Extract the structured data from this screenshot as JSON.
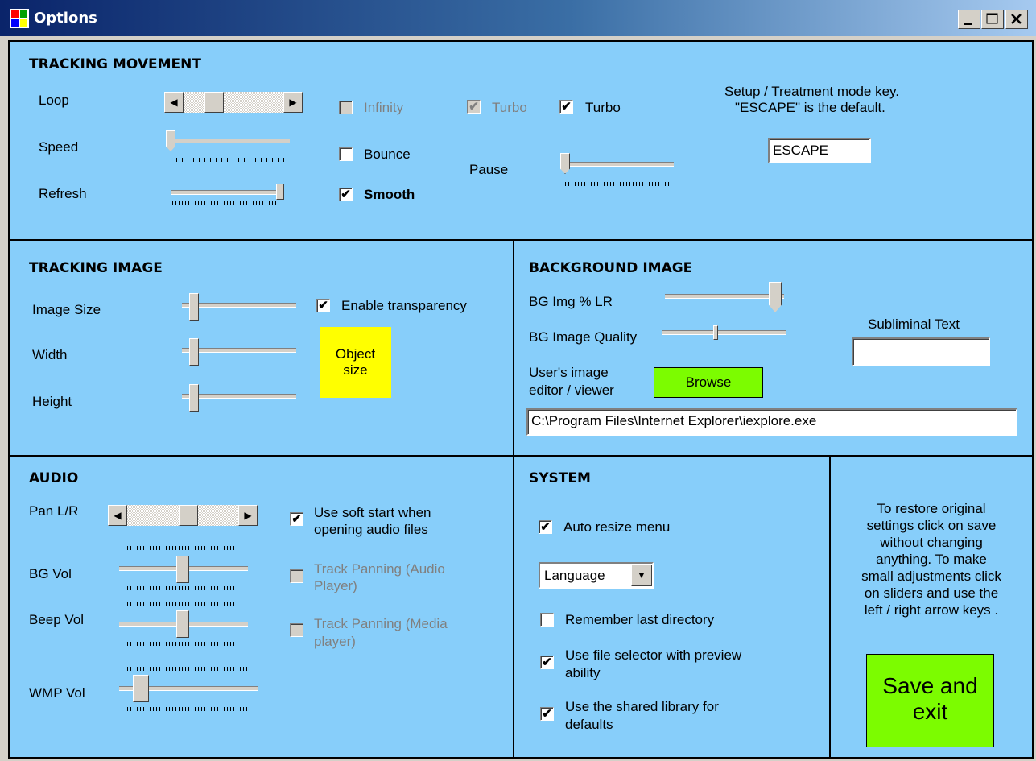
{
  "window": {
    "title": "Options",
    "minimize_icon": "minimize-icon",
    "maximize_icon": "maximize-icon",
    "close_icon": "close-icon"
  },
  "tracking_movement": {
    "heading": "TRACKING MOVEMENT",
    "loop_label": "Loop",
    "speed_label": "Speed",
    "refresh_label": "Refresh",
    "infinity_label": "Infinity",
    "infinity_checked": false,
    "infinity_enabled": false,
    "turbo_disabled_label": "Turbo",
    "turbo_disabled_checked": true,
    "turbo_label": "Turbo",
    "turbo_checked": true,
    "bounce_label": "Bounce",
    "bounce_checked": false,
    "smooth_label": "Smooth",
    "smooth_checked": true,
    "pause_label": "Pause",
    "mode_key_hint_line1": "Setup / Treatment mode key.",
    "mode_key_hint_line2": "\"ESCAPE\" is the default.",
    "mode_key_value": "ESCAPE"
  },
  "tracking_image": {
    "heading": "TRACKING IMAGE",
    "image_size_label": "Image Size",
    "width_label": "Width",
    "height_label": "Height",
    "transparency_label": "Enable transparency",
    "transparency_checked": true,
    "object_size_line1": "Object",
    "object_size_line2": "size",
    "object_size_color": "#ffff00"
  },
  "background_image": {
    "heading": "BACKGROUND IMAGE",
    "bg_lr_label": "BG Img % LR",
    "bg_quality_label": "BG Image Quality",
    "subliminal_label": "Subliminal Text",
    "subliminal_value": "",
    "editor_label_line1": "User's image",
    "editor_label_line2": "editor / viewer",
    "browse_label": "Browse",
    "browse_color": "#7cfc00",
    "editor_path": "C:\\Program Files\\Internet Explorer\\iexplore.exe"
  },
  "audio": {
    "heading": "AUDIO",
    "pan_label": "Pan L/R",
    "bg_vol_label": "BG Vol",
    "beep_vol_label": "Beep Vol",
    "wmp_vol_label": "WMP Vol",
    "soft_start_line1": "Use soft start when",
    "soft_start_line2": "opening audio files",
    "soft_start_checked": true,
    "track_panning_audio_line1": "Track Panning (Audio",
    "track_panning_audio_line2": "Player)",
    "track_panning_media_line1": "Track Panning (Media",
    "track_panning_media_line2": "player)"
  },
  "system": {
    "heading": "SYSTEM",
    "auto_resize_label": "Auto resize menu",
    "auto_resize_checked": true,
    "language_value": "Language",
    "remember_dir_label": "Remember last directory",
    "remember_dir_checked": false,
    "file_selector_line1": "Use file selector with preview",
    "file_selector_line2": "ability",
    "file_selector_checked": true,
    "shared_lib_line1": "Use the shared library for",
    "shared_lib_line2": "defaults",
    "shared_lib_checked": true
  },
  "save_panel": {
    "instructions": [
      "To restore original",
      "settings click on save",
      "without changing",
      "anything. To make",
      "small adjustments click",
      "on sliders and use the",
      "left / right arrow keys ."
    ],
    "save_line1": "Save and",
    "save_line2": "exit",
    "save_color": "#7cfc00"
  }
}
